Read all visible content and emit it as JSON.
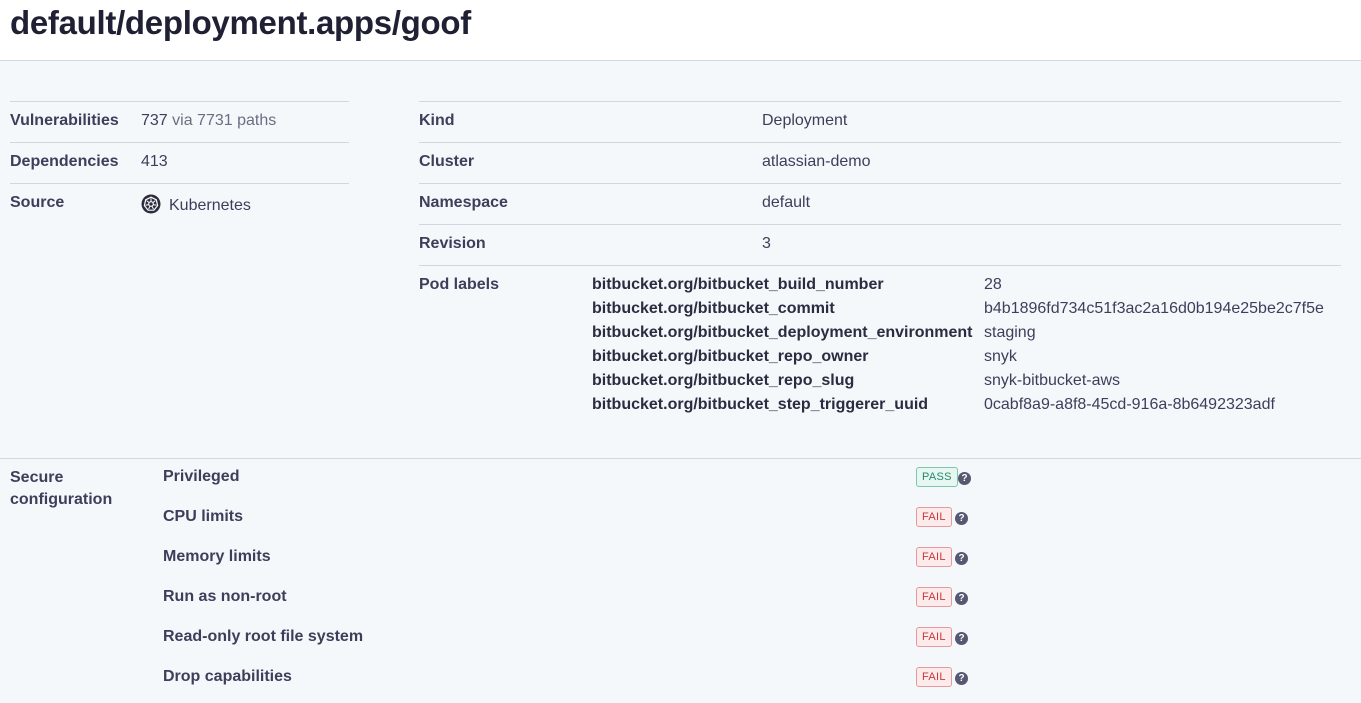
{
  "header": {
    "title": "default/deployment.apps/goof"
  },
  "summary": [
    {
      "key": "Vulnerabilities",
      "value": "737",
      "extra": "via 7731 paths"
    },
    {
      "key": "Dependencies",
      "value": "413"
    },
    {
      "key": "Source",
      "value": "Kubernetes",
      "icon": "kubernetes-icon"
    }
  ],
  "details": [
    {
      "key": "Kind",
      "value": "Deployment"
    },
    {
      "key": "Cluster",
      "value": "atlassian-demo"
    },
    {
      "key": "Namespace",
      "value": "default"
    },
    {
      "key": "Revision",
      "value": "3"
    }
  ],
  "pod_labels": {
    "title": "Pod labels",
    "items": [
      {
        "key": "bitbucket.org/bitbucket_build_number",
        "value": "28"
      },
      {
        "key": "bitbucket.org/bitbucket_commit",
        "value": "b4b1896fd734c51f3ac2a16d0b194e25be2c7f5e"
      },
      {
        "key": "bitbucket.org/bitbucket_deployment_environment",
        "value": "staging"
      },
      {
        "key": "bitbucket.org/bitbucket_repo_owner",
        "value": "snyk"
      },
      {
        "key": "bitbucket.org/bitbucket_repo_slug",
        "value": "snyk-bitbucket-aws"
      },
      {
        "key": "bitbucket.org/bitbucket_step_triggerer_uuid",
        "value": "0cabf8a9-a8f8-45cd-916a-8b6492323adf"
      }
    ]
  },
  "secure_configuration": {
    "title": "Secure configuration",
    "checks": [
      {
        "name": "Privileged",
        "status": "PASS"
      },
      {
        "name": "CPU limits",
        "status": "FAIL"
      },
      {
        "name": "Memory limits",
        "status": "FAIL"
      },
      {
        "name": "Run as non-root",
        "status": "FAIL"
      },
      {
        "name": "Read-only root file system",
        "status": "FAIL"
      },
      {
        "name": "Drop capabilities",
        "status": "FAIL"
      }
    ]
  },
  "colors": {
    "pass": "#258a6a",
    "fail": "#c43a3a",
    "background": "#f4f8fb"
  }
}
